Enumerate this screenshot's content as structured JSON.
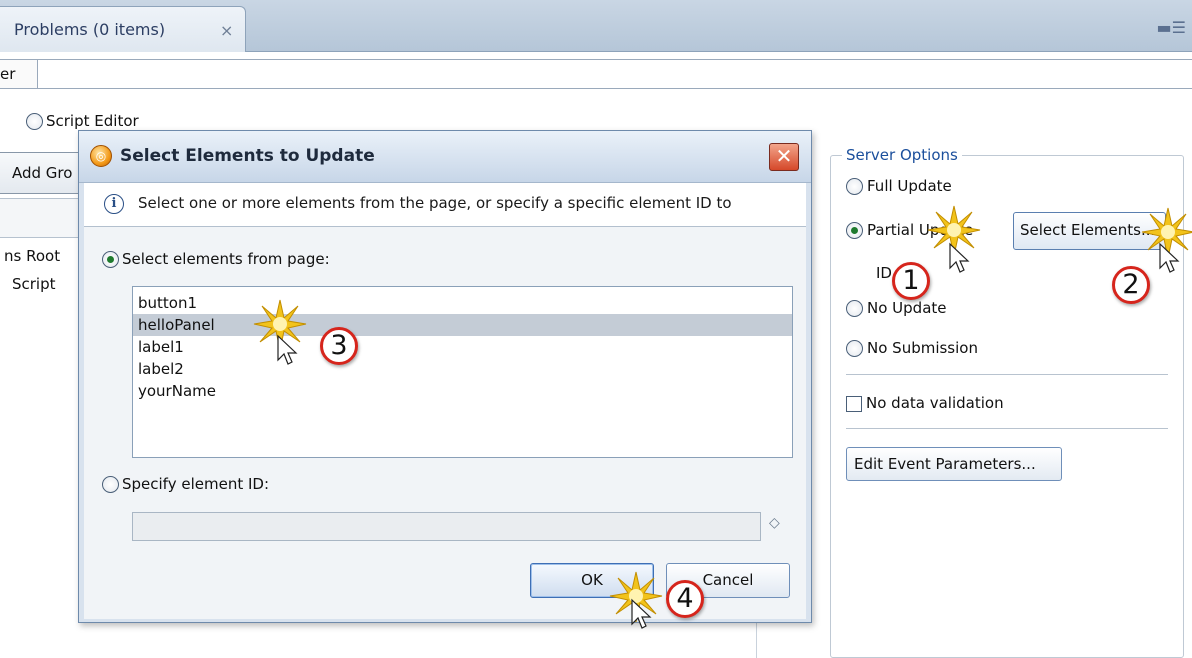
{
  "top_tab": {
    "label": "Problems (0 items)",
    "close_glyph": "×",
    "view_controls": "▬☰"
  },
  "filter_row": {
    "label_fragment": "er",
    "value": ""
  },
  "editor_mode": {
    "script_editor_label": "Script Editor",
    "selected": false
  },
  "left_panel": {
    "add_group_button": "Add Gro",
    "tree_items": [
      "ns Root",
      "Script"
    ]
  },
  "server_options": {
    "title": "Server Options",
    "full_update": {
      "label": "Full Update",
      "selected": false
    },
    "partial_update": {
      "label": "Partial Update",
      "selected": true
    },
    "select_elements_button": "Select Elements...",
    "id_label": "ID",
    "no_update": {
      "label": "No Update",
      "selected": false
    },
    "no_submission": {
      "label": "No Submission",
      "selected": false
    },
    "no_data_validation": {
      "label": "No data validation",
      "checked": false
    },
    "edit_event_parameters_button": "Edit Event Parameters..."
  },
  "dialog": {
    "title": "Select Elements to Update",
    "close_glyph": "✕",
    "info_text": "Select one or more elements from the page, or specify a specific element ID to",
    "select_from_page": {
      "label": "Select elements from page:",
      "selected": true
    },
    "elements": [
      "button1",
      "helloPanel",
      "label1",
      "label2",
      "yourName"
    ],
    "selected_element": "helloPanel",
    "specify_id": {
      "label": "Specify element ID:",
      "selected": false,
      "value": ""
    },
    "ok_button": "OK",
    "cancel_button": "Cancel"
  },
  "callouts": [
    "1",
    "2",
    "3",
    "4"
  ],
  "colors": {
    "accent": "#1b4f9c",
    "callout_ring": "#d6251c",
    "selection": "#c4ccd6",
    "burst": "#f2c31b"
  }
}
